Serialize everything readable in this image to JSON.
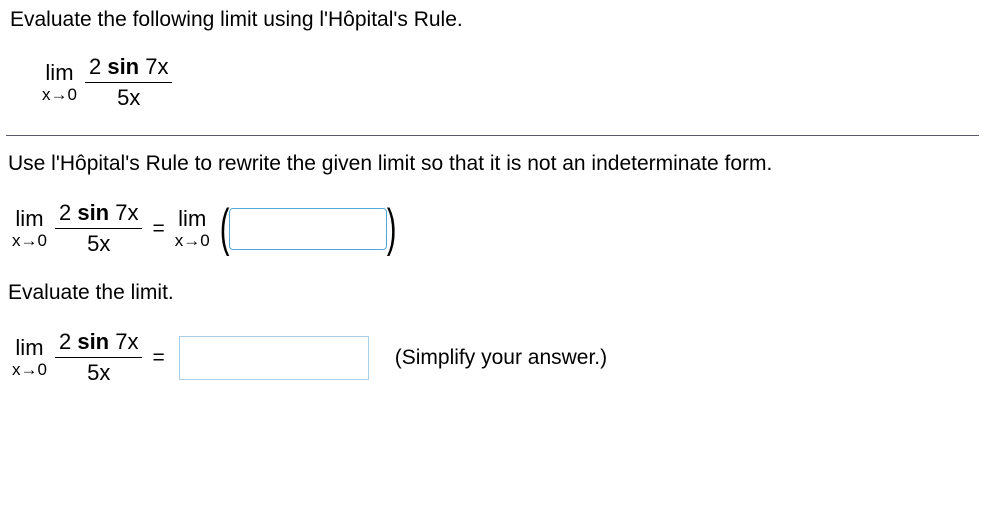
{
  "question": "Evaluate the following limit using l'Hôpital's Rule.",
  "limit": {
    "lim_word": "lim",
    "lim_sub": "x→0",
    "numerator_pre": "2 ",
    "numerator_sin": "sin ",
    "numerator_post": "7x",
    "denominator": "5x"
  },
  "instruction": "Use l'Hôpital's Rule to rewrite the given limit so that it is not an indeterminate form.",
  "equals": "=",
  "evaluate_label": "Evaluate the limit.",
  "hint": "(Simplify your answer.)"
}
